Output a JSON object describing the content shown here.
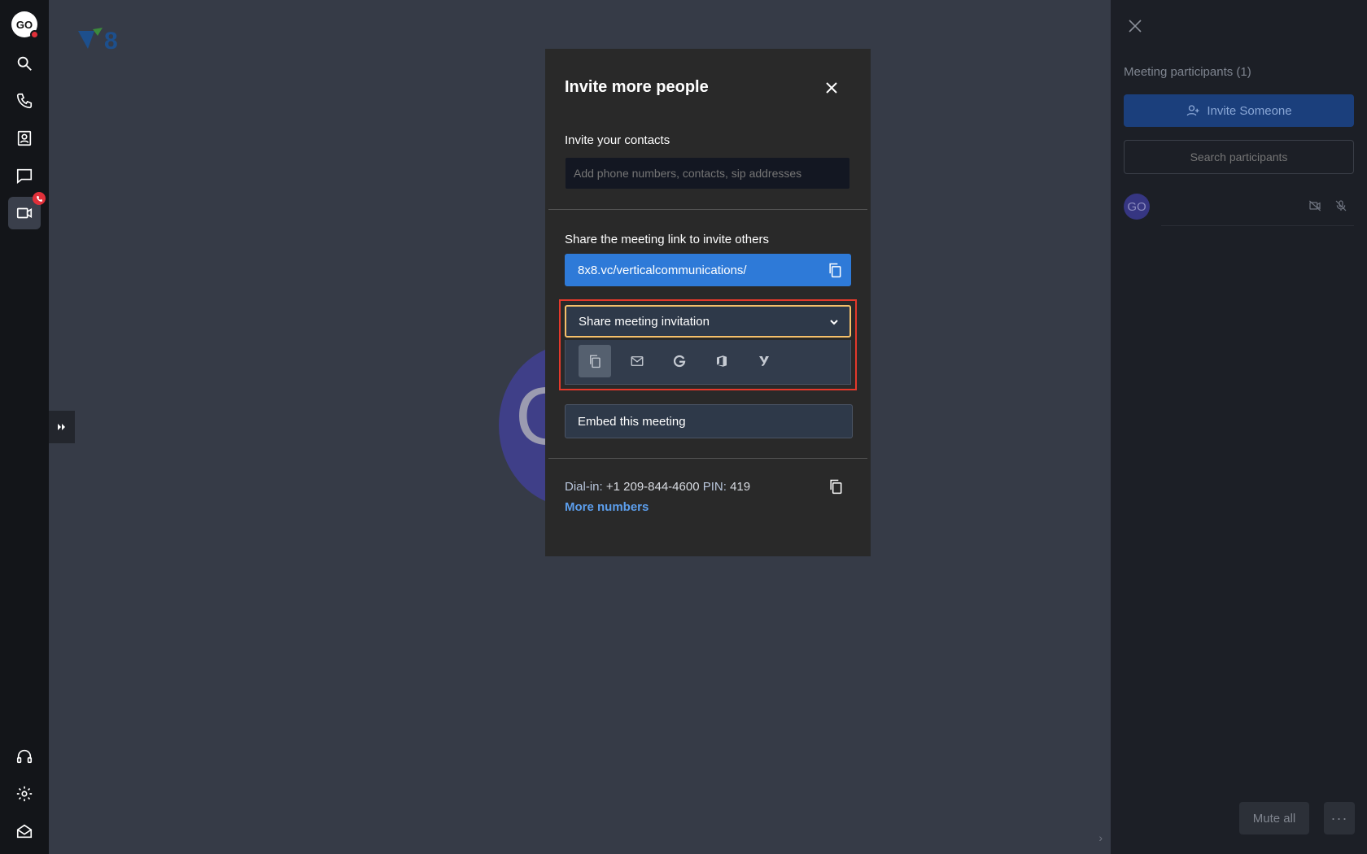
{
  "rail": {
    "avatar_initials": "GO"
  },
  "dialog": {
    "title": "Invite more people",
    "contacts_label": "Invite your contacts",
    "contacts_placeholder": "Add phone numbers, contacts, sip addresses",
    "share_link_label": "Share the meeting link to invite others",
    "meeting_link": "8x8.vc/verticalcommunications/",
    "share_select_label": "Share meeting invitation",
    "share_options": [
      "copy-icon",
      "email-icon",
      "google-icon",
      "office365-icon",
      "yahoo-icon"
    ],
    "embed_label": "Embed this meeting",
    "dialin_label": "Dial-in:",
    "dialin_number": "+1 209-844-4600",
    "pin_label": "PIN:",
    "pin_value": "419",
    "more_numbers": "More numbers"
  },
  "stage": {
    "bg_avatar_letter": "G"
  },
  "participants_panel": {
    "title": "Meeting participants (1)",
    "invite_button": "Invite Someone",
    "search_placeholder": "Search participants",
    "participants": [
      {
        "initials": "GO"
      }
    ],
    "mute_all": "Mute all",
    "more": "···"
  },
  "colors": {
    "accent_blue": "#2e7ad8",
    "focus_ring": "#f5c06a",
    "highlight_frame": "#e4392b",
    "badge_red": "#e0303a"
  }
}
